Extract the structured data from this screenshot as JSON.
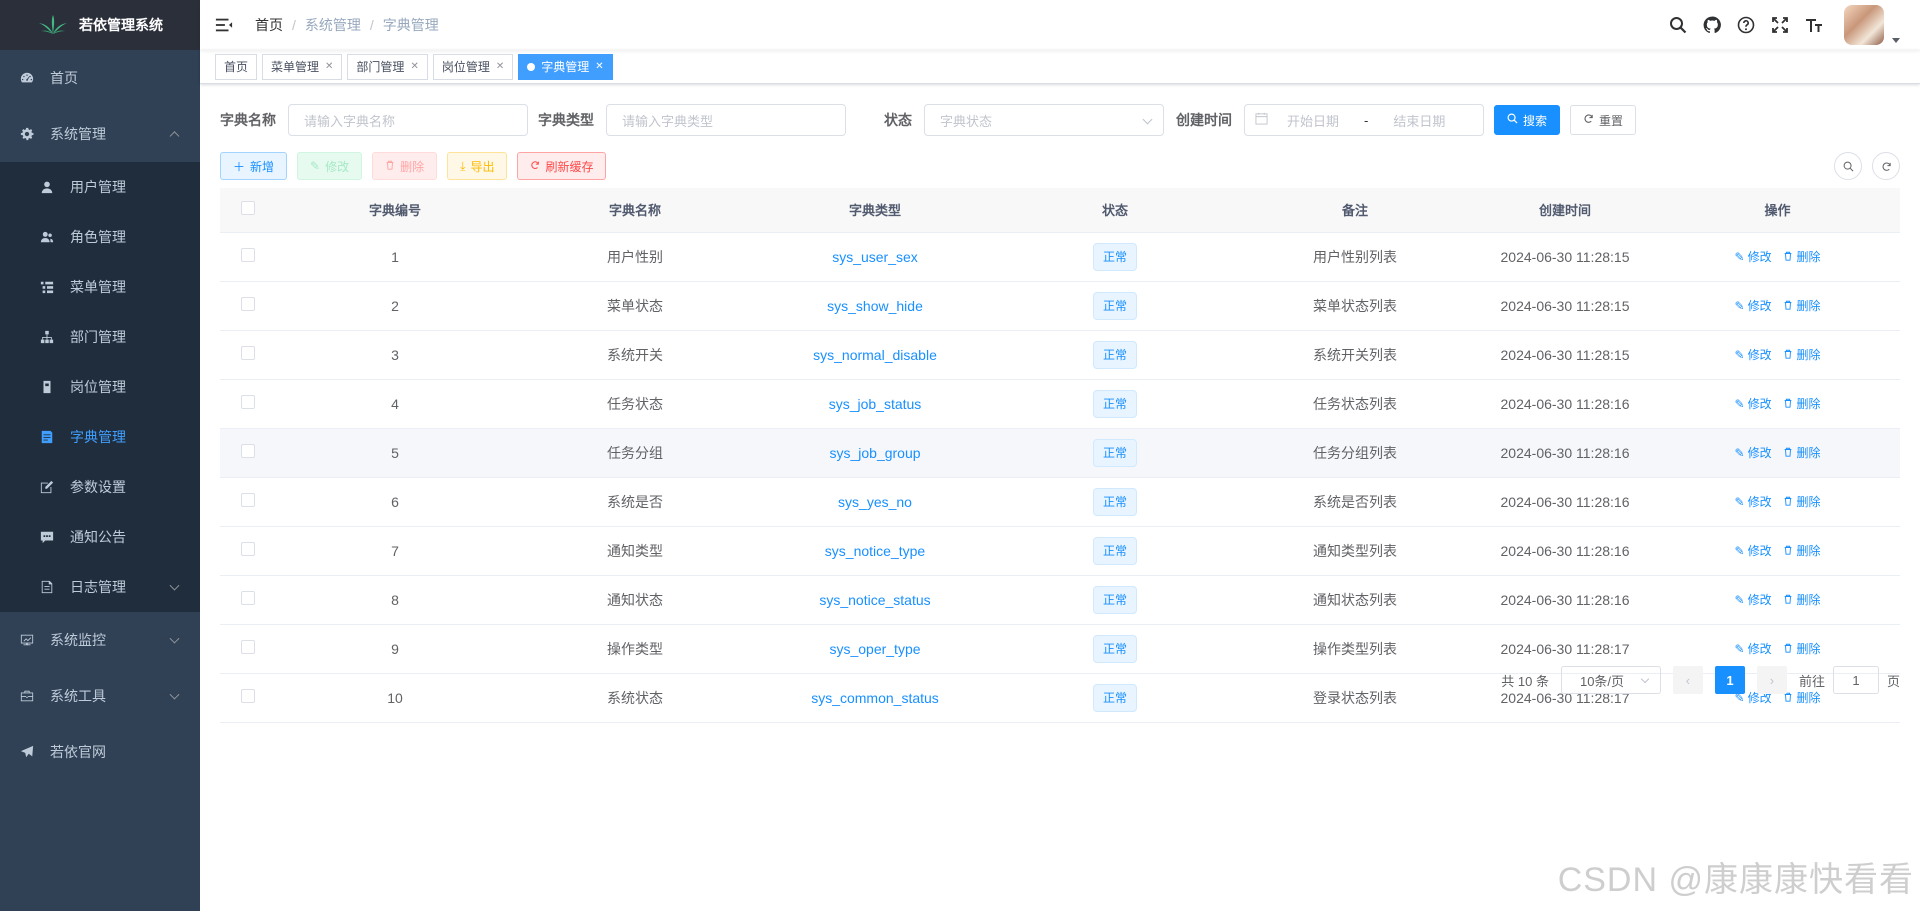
{
  "app": {
    "title": "若依管理系统"
  },
  "sidebar": {
    "home": "首页",
    "system": {
      "label": "系统管理",
      "items": [
        {
          "label": "用户管理",
          "icon": "user-icon"
        },
        {
          "label": "角色管理",
          "icon": "peoples-icon"
        },
        {
          "label": "菜单管理",
          "icon": "tree-table-icon"
        },
        {
          "label": "部门管理",
          "icon": "tree-icon"
        },
        {
          "label": "岗位管理",
          "icon": "post-icon"
        },
        {
          "label": "字典管理",
          "icon": "dict-icon",
          "active": true
        },
        {
          "label": "参数设置",
          "icon": "edit-icon"
        },
        {
          "label": "通知公告",
          "icon": "message-icon"
        },
        {
          "label": "日志管理",
          "icon": "log-icon"
        }
      ]
    },
    "monitor": "系统监控",
    "tool": "系统工具",
    "website": "若依官网"
  },
  "navbar": {
    "breadcrumb": [
      "首页",
      "系统管理",
      "字典管理"
    ]
  },
  "tags": [
    "首页",
    "菜单管理",
    "部门管理",
    "岗位管理",
    "字典管理"
  ],
  "search": {
    "dict_name_label": "字典名称",
    "dict_name_placeholder": "请输入字典名称",
    "dict_type_label": "字典类型",
    "dict_type_placeholder": "请输入字典类型",
    "status_label": "状态",
    "status_placeholder": "字典状态",
    "created_label": "创建时间",
    "start_placeholder": "开始日期",
    "end_placeholder": "结束日期",
    "range_sep": "-",
    "search_btn": "搜索",
    "reset_btn": "重置"
  },
  "toolbar": {
    "add": "新增",
    "edit": "修改",
    "delete": "删除",
    "export": "导出",
    "refresh_cache": "刷新缓存"
  },
  "table": {
    "headers": [
      "字典编号",
      "字典名称",
      "字典类型",
      "状态",
      "备注",
      "创建时间",
      "操作"
    ],
    "rows": [
      {
        "id": "1",
        "name": "用户性别",
        "type": "sys_user_sex",
        "status": "正常",
        "remark": "用户性别列表",
        "created": "2024-06-30 11:28:15"
      },
      {
        "id": "2",
        "name": "菜单状态",
        "type": "sys_show_hide",
        "status": "正常",
        "remark": "菜单状态列表",
        "created": "2024-06-30 11:28:15"
      },
      {
        "id": "3",
        "name": "系统开关",
        "type": "sys_normal_disable",
        "status": "正常",
        "remark": "系统开关列表",
        "created": "2024-06-30 11:28:15"
      },
      {
        "id": "4",
        "name": "任务状态",
        "type": "sys_job_status",
        "status": "正常",
        "remark": "任务状态列表",
        "created": "2024-06-30 11:28:16"
      },
      {
        "id": "5",
        "name": "任务分组",
        "type": "sys_job_group",
        "status": "正常",
        "remark": "任务分组列表",
        "created": "2024-06-30 11:28:16"
      },
      {
        "id": "6",
        "name": "系统是否",
        "type": "sys_yes_no",
        "status": "正常",
        "remark": "系统是否列表",
        "created": "2024-06-30 11:28:16"
      },
      {
        "id": "7",
        "name": "通知类型",
        "type": "sys_notice_type",
        "status": "正常",
        "remark": "通知类型列表",
        "created": "2024-06-30 11:28:16"
      },
      {
        "id": "8",
        "name": "通知状态",
        "type": "sys_notice_status",
        "status": "正常",
        "remark": "通知状态列表",
        "created": "2024-06-30 11:28:16"
      },
      {
        "id": "9",
        "name": "操作类型",
        "type": "sys_oper_type",
        "status": "正常",
        "remark": "操作类型列表",
        "created": "2024-06-30 11:28:17"
      },
      {
        "id": "10",
        "name": "系统状态",
        "type": "sys_common_status",
        "status": "正常",
        "remark": "登录状态列表",
        "created": "2024-06-30 11:28:17"
      }
    ],
    "op_edit": "修改",
    "op_delete": "删除"
  },
  "pagination": {
    "total": "共 10 条",
    "page_size": "10条/页",
    "current": "1",
    "goto_prefix": "前往",
    "goto_value": "1",
    "goto_suffix": "页"
  },
  "watermark": "CSDN @康康康快看看",
  "colors": {
    "sidebar_bg": "#304156",
    "accent": "#1890ff",
    "active_tag": "#409eff"
  }
}
